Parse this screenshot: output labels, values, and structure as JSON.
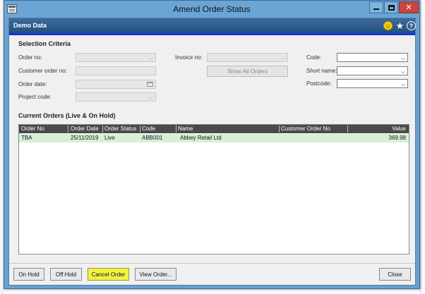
{
  "window": {
    "title": "Amend Order Status"
  },
  "header": {
    "company": "Demo Data",
    "icons": [
      "smiley-icon",
      "star-icon",
      "help-icon"
    ]
  },
  "selection": {
    "title": "Selection Criteria",
    "order_no_label": "Order no:",
    "customer_order_no_label": "Customer order no:",
    "order_date_label": "Order date:",
    "project_code_label": "Project code:",
    "invoice_no_label": "Invoice no:",
    "show_all_button": "Show All Orders",
    "code_label": "Code:",
    "short_name_label": "Short name:",
    "postcode_label": "Postcode:"
  },
  "orders": {
    "title": "Current Orders (Live & On Hold)",
    "columns": [
      "Order No",
      "Order Date",
      "Order Status",
      "Code",
      "Name",
      "Customer Order No",
      "Value"
    ],
    "rows": [
      {
        "order_no": "TBA",
        "order_date": "25/11/2019",
        "status": "Live",
        "code": "ABB001",
        "name": "Abbey Retail Ltd",
        "customer_order_no": "",
        "value": "369.98"
      }
    ]
  },
  "buttons": {
    "on_hold": "On Hold",
    "off_hold": "Off Hold",
    "cancel_order": "Cancel Order",
    "view_order": "View Order...",
    "close": "Close"
  },
  "colors": {
    "titlebar": "#6aa5d6",
    "header_band": "#2d5b8d",
    "selected_row": "#d7efd7",
    "highlight_button": "#f2f247"
  }
}
